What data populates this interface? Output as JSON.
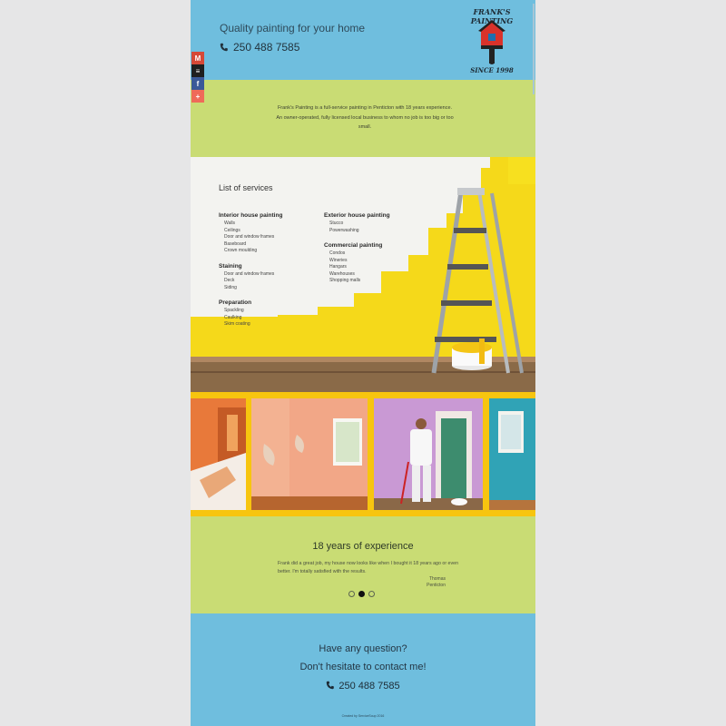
{
  "header": {
    "tagline": "Quality painting for your home",
    "phone": "250 488 7585",
    "logo": {
      "name": "FRANK'S PAINTING",
      "since": "SINCE 1998"
    }
  },
  "share": {
    "buttons": [
      {
        "label": "M",
        "icon": "gmail-icon",
        "color": "#d64937"
      },
      {
        "label": "≡",
        "icon": "buffer-icon",
        "color": "#1f1f1f"
      },
      {
        "label": "f",
        "icon": "facebook-icon",
        "color": "#3b5998"
      },
      {
        "label": "+",
        "icon": "more-icon",
        "color": "#ef6a59"
      }
    ]
  },
  "intro": {
    "text": "Frank's Painting is a full-service painting in Penticton with 18 years experience. An owner-operated, fully licensed local business to whom no job is too big or too small."
  },
  "services": {
    "title": "List of services",
    "left": [
      {
        "title": "Interior house painting",
        "items": [
          "Walls",
          "Ceilings",
          "Door and window frames",
          "Baseboard",
          "Crown moulding"
        ]
      },
      {
        "title": "Staining",
        "items": [
          "Door and window frames",
          "Deck",
          "Siding"
        ]
      },
      {
        "title": "Preparation",
        "items": [
          "Spackling",
          "Caulking",
          "Skim coating"
        ]
      }
    ],
    "right": [
      {
        "title": "Exterior house painting",
        "items": [
          "Stucco",
          "Powerwashing"
        ]
      },
      {
        "title": "Commercial painting",
        "items": [
          "Condos",
          "Wineries",
          "Hangars",
          "Warehouses",
          "Shopping malls"
        ]
      }
    ]
  },
  "testimonial": {
    "title": "18 years of experience",
    "quote": "Frank did a great job, my house now looks like when I bought it 18 years ago or even better. I'm totally satisfied with the results.",
    "author": "Thomas",
    "location": "Penticton",
    "slides": 3,
    "active_slide": 2
  },
  "contact": {
    "question": "Have any question?",
    "cta": "Don't hesitate to contact me!",
    "phone": "250 488 7585",
    "credit": "Created by ServiceSoup 2016"
  },
  "colors": {
    "blue": "#6fbede",
    "green": "#c9dc74",
    "yellow": "#f7c50f",
    "background": "#e6e6e7"
  }
}
